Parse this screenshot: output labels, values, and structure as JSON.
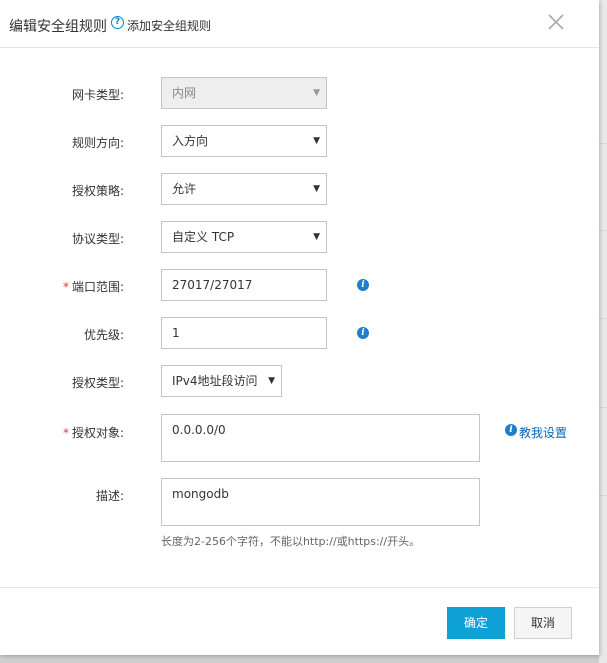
{
  "dialog": {
    "title": "编辑安全组规则",
    "help_icon_glyph": "?",
    "help_link": "添加安全组规则",
    "close_icon": "close-icon"
  },
  "form": {
    "nic_type": {
      "label": "网卡类型:",
      "value": "内网",
      "disabled": true
    },
    "direction": {
      "label": "规则方向:",
      "value": "入方向"
    },
    "policy": {
      "label": "授权策略:",
      "value": "允许"
    },
    "protocol": {
      "label": "协议类型:",
      "value": "自定义 TCP"
    },
    "port_range": {
      "required_mark": "*",
      "label": "端口范围:",
      "value": "27017/27017",
      "info_icon": "info-icon"
    },
    "priority": {
      "label": "优先级:",
      "value": "1",
      "info_icon": "info-icon"
    },
    "auth_type": {
      "label": "授权类型:",
      "value": "IPv4地址段访问"
    },
    "auth_object": {
      "required_mark": "*",
      "label": "授权对象:",
      "value": "0.0.0.0/0",
      "help_link": "教我设置"
    },
    "description": {
      "label": "描述:",
      "value": "mongodb",
      "hint": "长度为2-256个字符，不能以http://或https://开头。"
    }
  },
  "info_glyph": "i",
  "footer": {
    "ok_label": "确定",
    "cancel_label": "取消"
  },
  "colors": {
    "primary": "#0fa0d6",
    "link": "#0a66b1",
    "required": "#e4393c",
    "info": "#1f7fc8"
  }
}
